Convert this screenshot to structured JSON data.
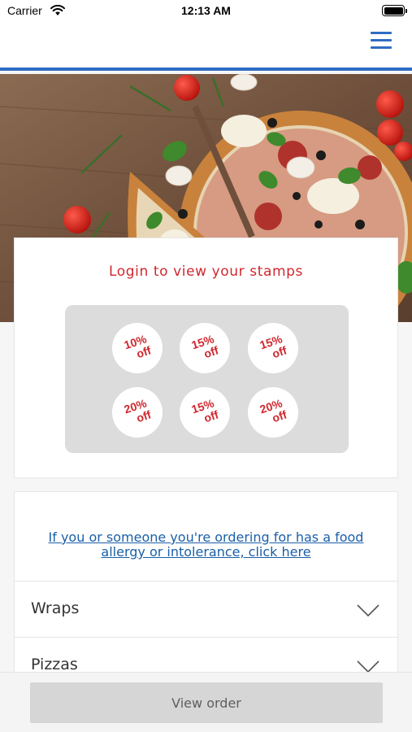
{
  "status_bar": {
    "carrier": "Carrier",
    "time": "12:13 AM"
  },
  "nav": {
    "menu_icon": "hamburger-menu-icon",
    "accent_color": "#2e6cc4"
  },
  "hero": {
    "image": "pizza-photo"
  },
  "stamp_card": {
    "title": "Login to view your stamps",
    "stamps": [
      {
        "pct": "10%",
        "off": "off"
      },
      {
        "pct": "15%",
        "off": "off"
      },
      {
        "pct": "15%",
        "off": "off"
      },
      {
        "pct": "20%",
        "off": "off"
      },
      {
        "pct": "15%",
        "off": "off"
      },
      {
        "pct": "20%",
        "off": "off"
      }
    ],
    "stamp_color": "#d0272e"
  },
  "allergy": {
    "link_text": "If you or someone you're ordering for has a food allergy or intolerance, click here",
    "link_color": "#1a5fa8"
  },
  "categories": [
    {
      "label": "Wraps",
      "icon": "chevron-down-icon"
    },
    {
      "label": "Pizzas",
      "icon": "chevron-down-icon"
    }
  ],
  "bottom_bar": {
    "view_order_label": "View order"
  }
}
